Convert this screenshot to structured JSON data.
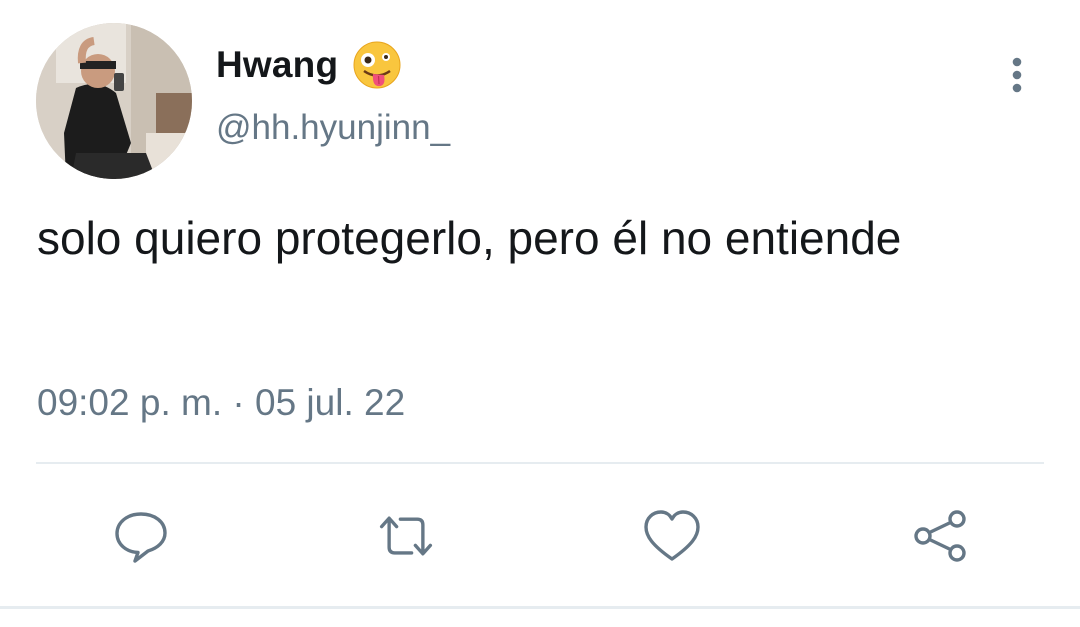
{
  "tweet": {
    "display_name": "Hwang",
    "handle": "@hh.hyunjinn_",
    "text": "solo quiero protegerlo, pero él no entiende",
    "timestamp": "09:02 p. m. · 05 jul. 22"
  },
  "icons": {
    "avatar": "avatar-photo",
    "emoji": "zany-face-emoji",
    "more": "more-vertical-icon",
    "reply": "reply-icon",
    "retweet": "retweet-icon",
    "like": "heart-icon",
    "share": "share-icon"
  },
  "colors": {
    "text": "#14171a",
    "secondary": "#657786",
    "divider": "#e6ecf0"
  }
}
